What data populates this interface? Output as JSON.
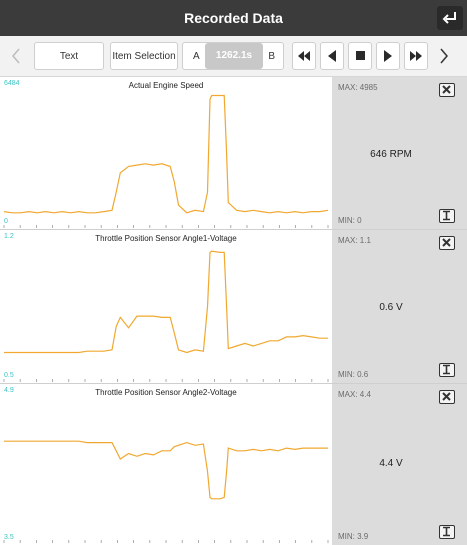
{
  "header": {
    "title": "Recorded Data"
  },
  "toolbar": {
    "text_label": "Text",
    "item_selection_label": "Item Selection",
    "a_label": "A",
    "time_value": "1262.1s",
    "b_label": "B"
  },
  "colors": {
    "trace": "#f0a830",
    "axis_label": "#3ec3c3",
    "titlebar": "#3b3b3b"
  },
  "panels": [
    {
      "name": "Actual Engine Speed",
      "y_top_label": "6484",
      "y_bottom_label": "0",
      "max": "MAX: 4985",
      "min": "MIN: 0",
      "current": "646 RPM",
      "series": [
        [
          0,
          0.05
        ],
        [
          1,
          0.04
        ],
        [
          2,
          0.04
        ],
        [
          3,
          0.05
        ],
        [
          4,
          0.04
        ],
        [
          5,
          0.05
        ],
        [
          6,
          0.04
        ],
        [
          7,
          0.05
        ],
        [
          8,
          0.04
        ],
        [
          9,
          0.05
        ],
        [
          10,
          0.04
        ],
        [
          11,
          0.04
        ],
        [
          12,
          0.05
        ],
        [
          13,
          0.06
        ],
        [
          13.5,
          0.2
        ],
        [
          14,
          0.35
        ],
        [
          15,
          0.4
        ],
        [
          16,
          0.41
        ],
        [
          17,
          0.42
        ],
        [
          18,
          0.41
        ],
        [
          19,
          0.42
        ],
        [
          20,
          0.4
        ],
        [
          20.5,
          0.28
        ],
        [
          21,
          0.1
        ],
        [
          22,
          0.04
        ],
        [
          23,
          0.06
        ],
        [
          24,
          0.05
        ],
        [
          24.5,
          0.2
        ],
        [
          24.8,
          0.92
        ],
        [
          25,
          0.95
        ],
        [
          26,
          0.95
        ],
        [
          26.5,
          0.95
        ],
        [
          26.8,
          0.5
        ],
        [
          27,
          0.12
        ],
        [
          28,
          0.06
        ],
        [
          29,
          0.05
        ],
        [
          30,
          0.06
        ],
        [
          31,
          0.05
        ],
        [
          32,
          0.04
        ],
        [
          33,
          0.05
        ],
        [
          34,
          0.04
        ],
        [
          35,
          0.05
        ],
        [
          36,
          0.04
        ],
        [
          37,
          0.05
        ],
        [
          38,
          0.05
        ],
        [
          39,
          0.06
        ]
      ]
    },
    {
      "name": "Throttle Position Sensor Angle1-Voltage",
      "y_top_label": "1.2",
      "y_bottom_label": "0.5",
      "max": "MAX: 1.1",
      "min": "MIN: 0.6",
      "current": "0.6 V",
      "series": [
        [
          0,
          0.15
        ],
        [
          1,
          0.15
        ],
        [
          2,
          0.15
        ],
        [
          3,
          0.15
        ],
        [
          4,
          0.15
        ],
        [
          5,
          0.15
        ],
        [
          6,
          0.15
        ],
        [
          7,
          0.15
        ],
        [
          8,
          0.15
        ],
        [
          9,
          0.15
        ],
        [
          10,
          0.16
        ],
        [
          11,
          0.16
        ],
        [
          12,
          0.16
        ],
        [
          13,
          0.17
        ],
        [
          13.5,
          0.35
        ],
        [
          14,
          0.42
        ],
        [
          15,
          0.34
        ],
        [
          16,
          0.43
        ],
        [
          17,
          0.43
        ],
        [
          18,
          0.43
        ],
        [
          19,
          0.42
        ],
        [
          20,
          0.42
        ],
        [
          20.5,
          0.3
        ],
        [
          21,
          0.17
        ],
        [
          22,
          0.15
        ],
        [
          23,
          0.17
        ],
        [
          24,
          0.16
        ],
        [
          24.5,
          0.5
        ],
        [
          24.8,
          0.92
        ],
        [
          25,
          0.93
        ],
        [
          26,
          0.92
        ],
        [
          26.5,
          0.92
        ],
        [
          26.8,
          0.5
        ],
        [
          27,
          0.18
        ],
        [
          28,
          0.2
        ],
        [
          29,
          0.22
        ],
        [
          30,
          0.2
        ],
        [
          31,
          0.22
        ],
        [
          32,
          0.24
        ],
        [
          33,
          0.24
        ],
        [
          34,
          0.27
        ],
        [
          35,
          0.27
        ],
        [
          36,
          0.28
        ],
        [
          37,
          0.27
        ],
        [
          38,
          0.26
        ],
        [
          39,
          0.26
        ]
      ]
    },
    {
      "name": "Throttle Position Sensor Angle2-Voltage",
      "y_top_label": "4.9",
      "y_bottom_label": "3.5",
      "max": "MAX: 4.4",
      "min": "MIN: 3.9",
      "current": "4.4 V",
      "series": [
        [
          0,
          0.67
        ],
        [
          1,
          0.67
        ],
        [
          2,
          0.67
        ],
        [
          3,
          0.67
        ],
        [
          4,
          0.67
        ],
        [
          5,
          0.67
        ],
        [
          6,
          0.67
        ],
        [
          7,
          0.67
        ],
        [
          8,
          0.67
        ],
        [
          9,
          0.67
        ],
        [
          10,
          0.66
        ],
        [
          11,
          0.66
        ],
        [
          12,
          0.66
        ],
        [
          13,
          0.66
        ],
        [
          13.5,
          0.6
        ],
        [
          14,
          0.54
        ],
        [
          15,
          0.58
        ],
        [
          16,
          0.56
        ],
        [
          17,
          0.58
        ],
        [
          18,
          0.57
        ],
        [
          19,
          0.6
        ],
        [
          20,
          0.6
        ],
        [
          20.5,
          0.63
        ],
        [
          21,
          0.64
        ],
        [
          22,
          0.66
        ],
        [
          23,
          0.64
        ],
        [
          24,
          0.65
        ],
        [
          24.5,
          0.45
        ],
        [
          24.8,
          0.26
        ],
        [
          25,
          0.25
        ],
        [
          26,
          0.25
        ],
        [
          26.5,
          0.26
        ],
        [
          26.8,
          0.45
        ],
        [
          27,
          0.62
        ],
        [
          28,
          0.6
        ],
        [
          29,
          0.6
        ],
        [
          30,
          0.61
        ],
        [
          31,
          0.6
        ],
        [
          32,
          0.61
        ],
        [
          33,
          0.6
        ],
        [
          34,
          0.62
        ],
        [
          35,
          0.61
        ],
        [
          36,
          0.62
        ],
        [
          37,
          0.62
        ],
        [
          38,
          0.62
        ],
        [
          39,
          0.62
        ]
      ]
    }
  ]
}
